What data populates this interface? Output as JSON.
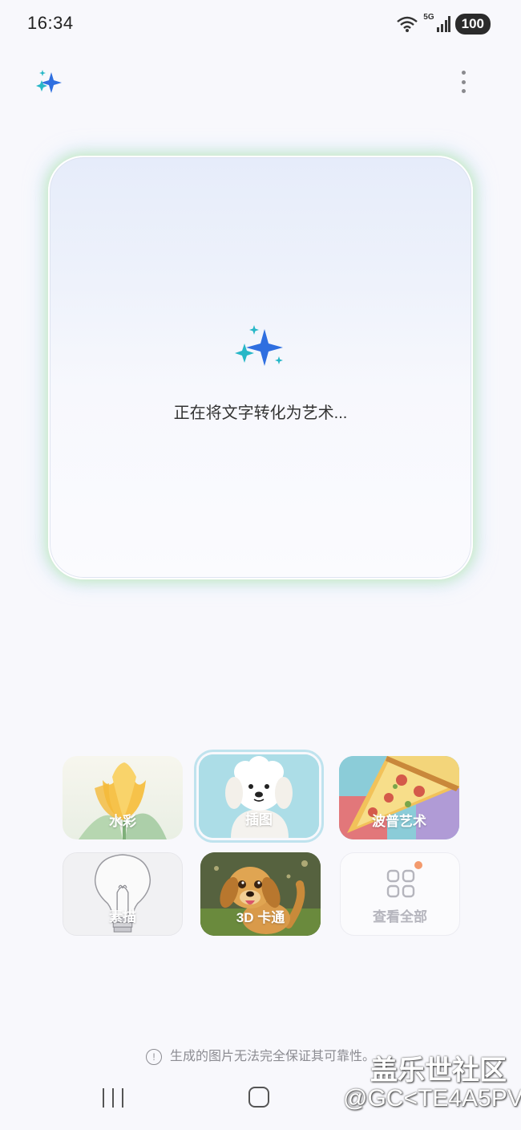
{
  "status_bar": {
    "time": "16:34",
    "network": "5G",
    "battery": "100"
  },
  "header": {
    "app_icon": "sparkle-icon",
    "menu_icon": "more-vertical-icon"
  },
  "canvas": {
    "loading_text": "正在将文字转化为艺术..."
  },
  "styles": [
    {
      "label": "水彩",
      "icon": "tulip-image"
    },
    {
      "label": "插图",
      "icon": "dog-illustration-image",
      "selected": true
    },
    {
      "label": "波普艺术",
      "icon": "pizza-image"
    },
    {
      "label": "素描",
      "icon": "lightbulb-sketch-image"
    },
    {
      "label": "3D 卡通",
      "icon": "cartoon-dog-image"
    },
    {
      "label": "查看全部",
      "icon": "grid-icon"
    }
  ],
  "disclaimer": "生成的图片无法完全保证其可靠性。",
  "watermark": {
    "line1": "盖乐世社区",
    "line2": "@GC<TE4A5PV"
  },
  "colors": {
    "accent_blue": "#2f6fe0",
    "accent_teal": "#27b7c7",
    "badge": "#f39a6d"
  }
}
